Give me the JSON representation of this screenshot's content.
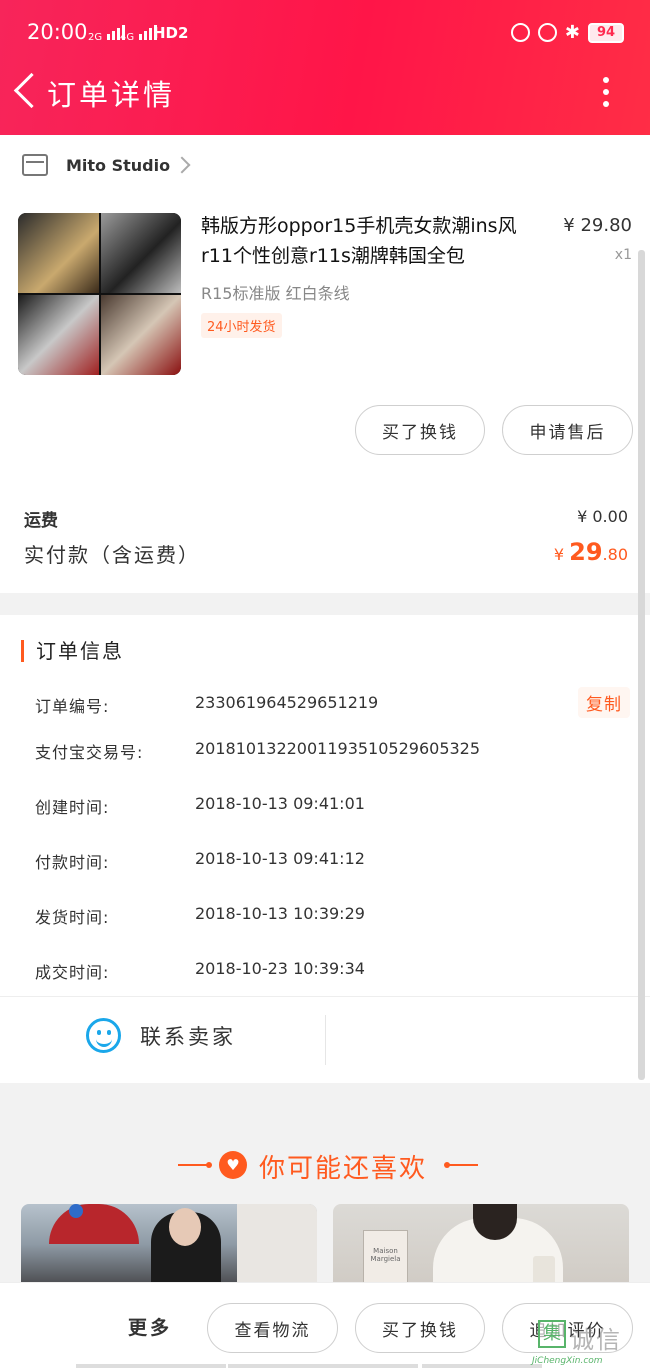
{
  "statusbar": {
    "time": "20:00",
    "net1": "2G",
    "net2": "4G",
    "hd": "HD2",
    "battery": "94"
  },
  "header": {
    "title": "订单详情"
  },
  "shop": {
    "name": "Mito Studio"
  },
  "product": {
    "title": "韩版方形oppor15手机壳女款潮ins风r11个性创意r11s潮牌韩国全包",
    "price": "¥ 29.80",
    "qty": "x1",
    "spec": "R15标准版 红白条线",
    "tag": "24小时发货"
  },
  "actions": {
    "buy_replace": "买了换钱",
    "after_sale": "申请售后"
  },
  "fees": {
    "shipping_label": "运费",
    "shipping_value": "¥ 0.00",
    "paid_label": "实付款（含运费）",
    "paid_currency": "¥ ",
    "paid_int": "29",
    "paid_dec": ".80"
  },
  "order_info": {
    "title": "订单信息",
    "copy_label": "复制",
    "rows": [
      {
        "label": "订单编号:",
        "value": "233061964529651219"
      },
      {
        "label": "支付宝交易号:",
        "value": "2018101322001193510529605325"
      },
      {
        "label": "创建时间:",
        "value": "2018-10-13 09:41:01"
      },
      {
        "label": "付款时间:",
        "value": "2018-10-13 09:41:12"
      },
      {
        "label": "发货时间:",
        "value": "2018-10-13 10:39:29"
      },
      {
        "label": "成交时间:",
        "value": "2018-10-23 10:39:34"
      }
    ],
    "contact_label": "联系卖家"
  },
  "recommend": {
    "title": "你可能还喜欢",
    "bag_text": "Maison Margiela"
  },
  "bottom_bar": {
    "more_label": "更多",
    "logistics": "查看物流",
    "buy_replace": "买了换钱",
    "add_review": "追加评价"
  },
  "watermark": {
    "box": "集",
    "text": "诚信",
    "sub": "JiChengXin.com"
  },
  "colors": {
    "header": "#ff1e4e",
    "accent": "#ff5a1f",
    "contact_icon": "#1aa7ea"
  }
}
